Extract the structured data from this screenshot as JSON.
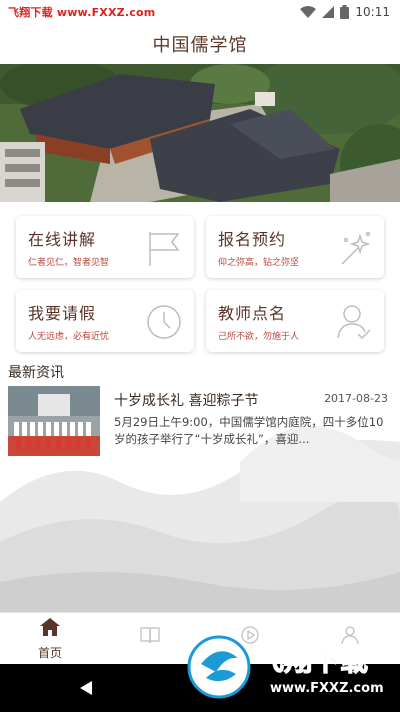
{
  "status_bar": {
    "watermark": "飞翔下载 www.FXXZ.com",
    "time": "10:11",
    "icons": [
      "wifi-icon",
      "signal-icon",
      "battery-icon"
    ]
  },
  "header": {
    "title": "中国儒学馆"
  },
  "cards": [
    {
      "title": "在线讲解",
      "subtitle": "仁者见仁，智者见智",
      "icon": "flag-icon"
    },
    {
      "title": "报名预约",
      "subtitle": "仰之弥高，钻之弥坚",
      "icon": "sparkle-icon"
    },
    {
      "title": "我要请假",
      "subtitle": "人无远虑，必有近忧",
      "icon": "clock-icon"
    },
    {
      "title": "教师点名",
      "subtitle": "己所不欲，勿施于人",
      "icon": "user-check-icon"
    }
  ],
  "news": {
    "header": "最新资讯",
    "items": [
      {
        "title": "十岁成长礼 喜迎粽子节",
        "date": "2017-08-23",
        "summary": "5月29日上午9:00，中国儒学馆内庭院，四十多位10岁的孩子举行了“十岁成长礼”，喜迎..."
      }
    ]
  },
  "tab_bar": {
    "tabs": [
      {
        "label": "首页",
        "icon": "home-icon",
        "active": true
      },
      {
        "label": "",
        "icon": "book-icon",
        "active": false
      },
      {
        "label": "",
        "icon": "play-icon",
        "active": false
      },
      {
        "label": "",
        "icon": "person-icon",
        "active": false
      }
    ]
  },
  "watermark_logo": {
    "text": "飞翔下载",
    "url": "www.FXXZ.com"
  },
  "colors": {
    "accent": "#5a3428",
    "subtitle": "#b8443a",
    "watermark_red": "#e0201b"
  }
}
